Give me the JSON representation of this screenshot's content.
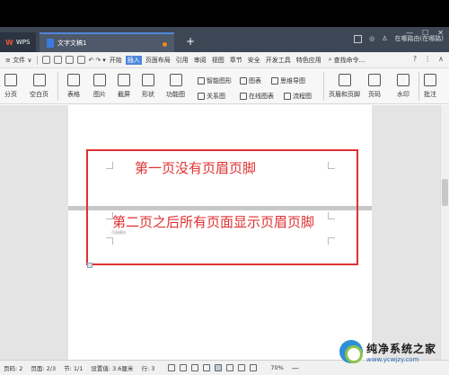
{
  "titlebar": {
    "app_label": "WPS",
    "doc_tab_label": "文字文稿1",
    "new_tab": "+",
    "right_text": "在哪路由(在哪路)",
    "window_controls": [
      "—",
      "☐",
      "✕"
    ]
  },
  "menubar": {
    "file_menu": "≡ 文件 ∨",
    "items": [
      "开始",
      "插入",
      "页面布局",
      "引用",
      "审阅",
      "视图",
      "章节",
      "安全",
      "开发工具",
      "特色应用"
    ],
    "active_item": "插入",
    "search": "查找命令...",
    "right_icons": [
      "?",
      "⋮",
      "∧"
    ]
  },
  "ribbon": {
    "page_break": "分页",
    "blank_page": "空白页",
    "table": "表格",
    "picture": "图片",
    "screenshot": "截屏",
    "shape": "形状",
    "function_chart": "功能图",
    "smart_shape": "智能图形",
    "chart": "图表",
    "mind_map": "思维导图",
    "relation_chart": "关系图",
    "online_chart": "在线图表",
    "flowchart": "流程图",
    "header_footer": "页眉和页脚",
    "page_number": "页码",
    "watermark": "水印",
    "comment": "批注"
  },
  "document": {
    "line1": "第一页没有页眉页脚",
    "line2": "第二页之后所有页面显示页眉页脚",
    "header_label": "页眉横线",
    "highlight_color": "#e03030"
  },
  "statusbar": {
    "page_num": "页码: 2",
    "page_of": "页面: 2/3",
    "section": "节: 1/1",
    "setting": "设置值: 3.6厘米",
    "row": "行: 3",
    "zoom": "70%",
    "zoom_minus": "—"
  },
  "watermark": {
    "title": "纯净系统之家",
    "url": "www.ycwjzy.com"
  }
}
